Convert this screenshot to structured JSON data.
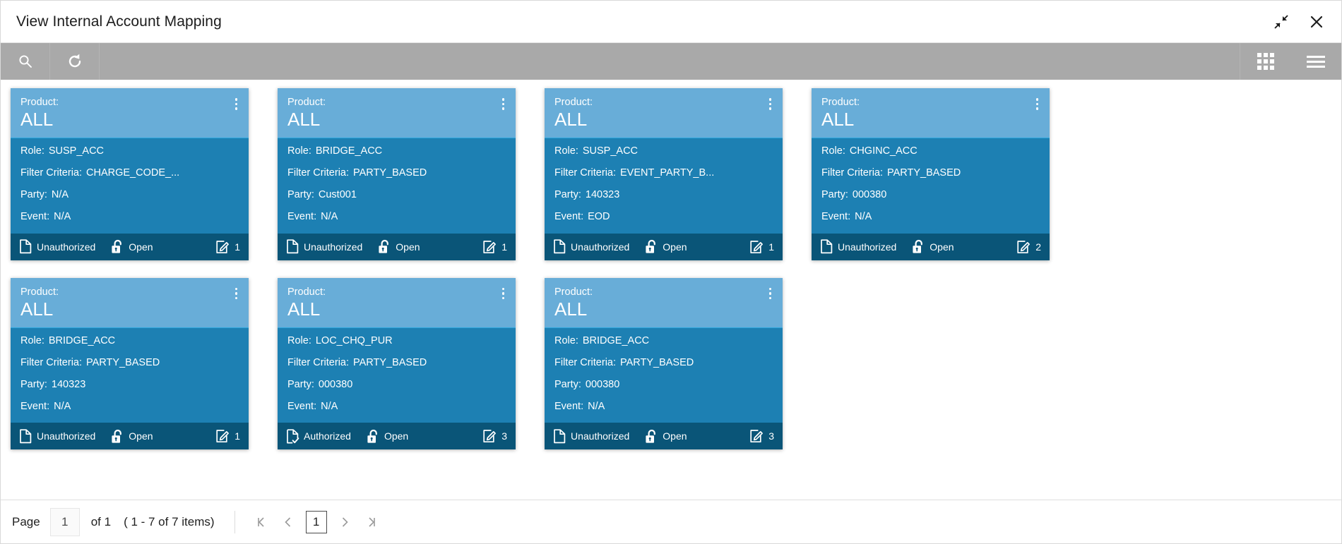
{
  "window": {
    "title": "View Internal Account Mapping",
    "minimize_icon": "collapse-arrows-icon",
    "close_icon": "close-icon"
  },
  "toolbar": {
    "search_icon": "search-icon",
    "refresh_icon": "refresh-icon",
    "grid_view_icon": "grid-view-icon",
    "list_view_icon": "list-view-icon"
  },
  "colors": {
    "card_header": "#68ADD8",
    "card_body": "#1d80b3",
    "card_footer": "#0a5578",
    "toolbar": "#a9a9a9",
    "divider": "#2fa6dd"
  },
  "card_labels": {
    "product": "Product:",
    "role": "Role:",
    "filter_criteria": "Filter Criteria:",
    "party": "Party:",
    "event": "Event:"
  },
  "cards": [
    {
      "product": "ALL",
      "role": "SUSP_ACC",
      "filter_criteria": "CHARGE_CODE_...",
      "party": "N/A",
      "event": "N/A",
      "auth_status": "Unauthorized",
      "auth_icon": "document-icon",
      "record_status": "Open",
      "lock_icon": "unlock-icon",
      "mod_count": "1",
      "mod_icon": "edit-icon"
    },
    {
      "product": "ALL",
      "role": "BRIDGE_ACC",
      "filter_criteria": "PARTY_BASED",
      "party": "Cust001",
      "event": "N/A",
      "auth_status": "Unauthorized",
      "auth_icon": "document-icon",
      "record_status": "Open",
      "lock_icon": "unlock-icon",
      "mod_count": "1",
      "mod_icon": "edit-icon"
    },
    {
      "product": "ALL",
      "role": "SUSP_ACC",
      "filter_criteria": "EVENT_PARTY_B...",
      "party": "140323",
      "event": "EOD",
      "auth_status": "Unauthorized",
      "auth_icon": "document-icon",
      "record_status": "Open",
      "lock_icon": "unlock-icon",
      "mod_count": "1",
      "mod_icon": "edit-icon"
    },
    {
      "product": "ALL",
      "role": "CHGINC_ACC",
      "filter_criteria": "PARTY_BASED",
      "party": "000380",
      "event": "N/A",
      "auth_status": "Unauthorized",
      "auth_icon": "document-icon",
      "record_status": "Open",
      "lock_icon": "unlock-icon",
      "mod_count": "2",
      "mod_icon": "edit-icon"
    },
    {
      "product": "ALL",
      "role": "BRIDGE_ACC",
      "filter_criteria": "PARTY_BASED",
      "party": "140323",
      "event": "N/A",
      "auth_status": "Unauthorized",
      "auth_icon": "document-icon",
      "record_status": "Open",
      "lock_icon": "unlock-icon",
      "mod_count": "1",
      "mod_icon": "edit-icon"
    },
    {
      "product": "ALL",
      "role": "LOC_CHQ_PUR",
      "filter_criteria": "PARTY_BASED",
      "party": "000380",
      "event": "N/A",
      "auth_status": "Authorized",
      "auth_icon": "document-check-icon",
      "record_status": "Open",
      "lock_icon": "unlock-icon",
      "mod_count": "3",
      "mod_icon": "edit-icon"
    },
    {
      "product": "ALL",
      "role": "BRIDGE_ACC",
      "filter_criteria": "PARTY_BASED",
      "party": "000380",
      "event": "N/A",
      "auth_status": "Unauthorized",
      "auth_icon": "document-icon",
      "record_status": "Open",
      "lock_icon": "unlock-icon",
      "mod_count": "3",
      "mod_icon": "edit-icon"
    }
  ],
  "pagination": {
    "page_label": "Page",
    "page_value": "1",
    "of_text": "of 1",
    "items_text": "( 1 - 7 of 7 items)",
    "first_icon": "first-page-icon",
    "prev_icon": "prev-page-icon",
    "current_page": "1",
    "next_icon": "next-page-icon",
    "last_icon": "last-page-icon"
  }
}
